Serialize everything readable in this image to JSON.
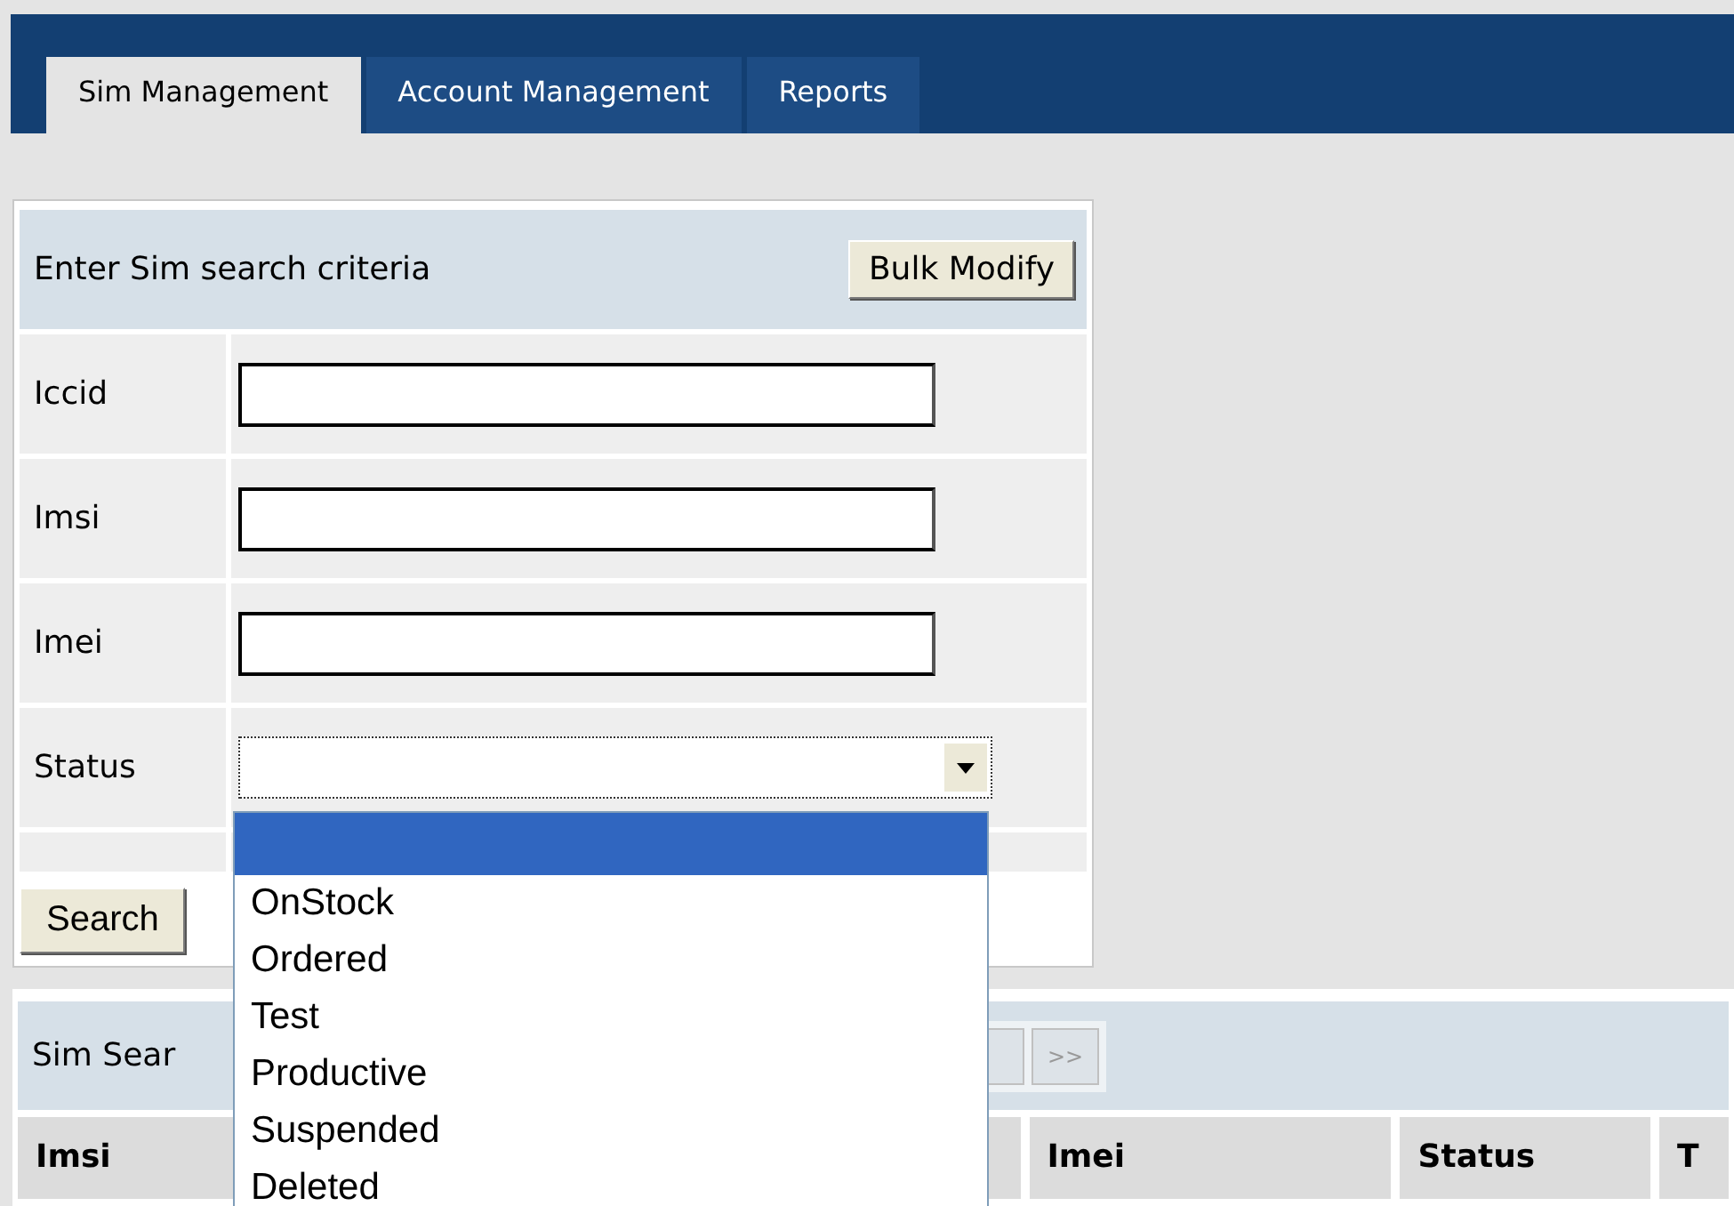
{
  "tabs": [
    {
      "label": "Sim Management",
      "selected": true
    },
    {
      "label": "Account Management",
      "selected": false
    },
    {
      "label": "Reports",
      "selected": false
    }
  ],
  "search_panel": {
    "title": "Enter Sim search criteria",
    "bulk_button": "Bulk Modify",
    "fields": [
      {
        "kind": "text",
        "label": "Iccid"
      },
      {
        "kind": "text",
        "label": "Imsi"
      },
      {
        "kind": "text",
        "label": "Imei"
      },
      {
        "kind": "select",
        "label": "Status",
        "open": true
      }
    ],
    "search_button": "Search"
  },
  "results": {
    "title": "Sim Sear",
    "pager": [
      {
        "label": ">>",
        "disabled": true
      }
    ],
    "columns": [
      "Imsi",
      "Imei",
      "Status",
      "T"
    ]
  },
  "status_dropdown": {
    "options": [
      {
        "selected": true
      },
      {
        "label": "OnStock",
        "selected": false
      },
      {
        "label": "Ordered",
        "selected": false
      },
      {
        "label": "Test",
        "selected": false
      },
      {
        "label": "Productive",
        "selected": false
      },
      {
        "label": "Suspended",
        "selected": false
      },
      {
        "label": "Deleted",
        "selected": false
      }
    ]
  }
}
